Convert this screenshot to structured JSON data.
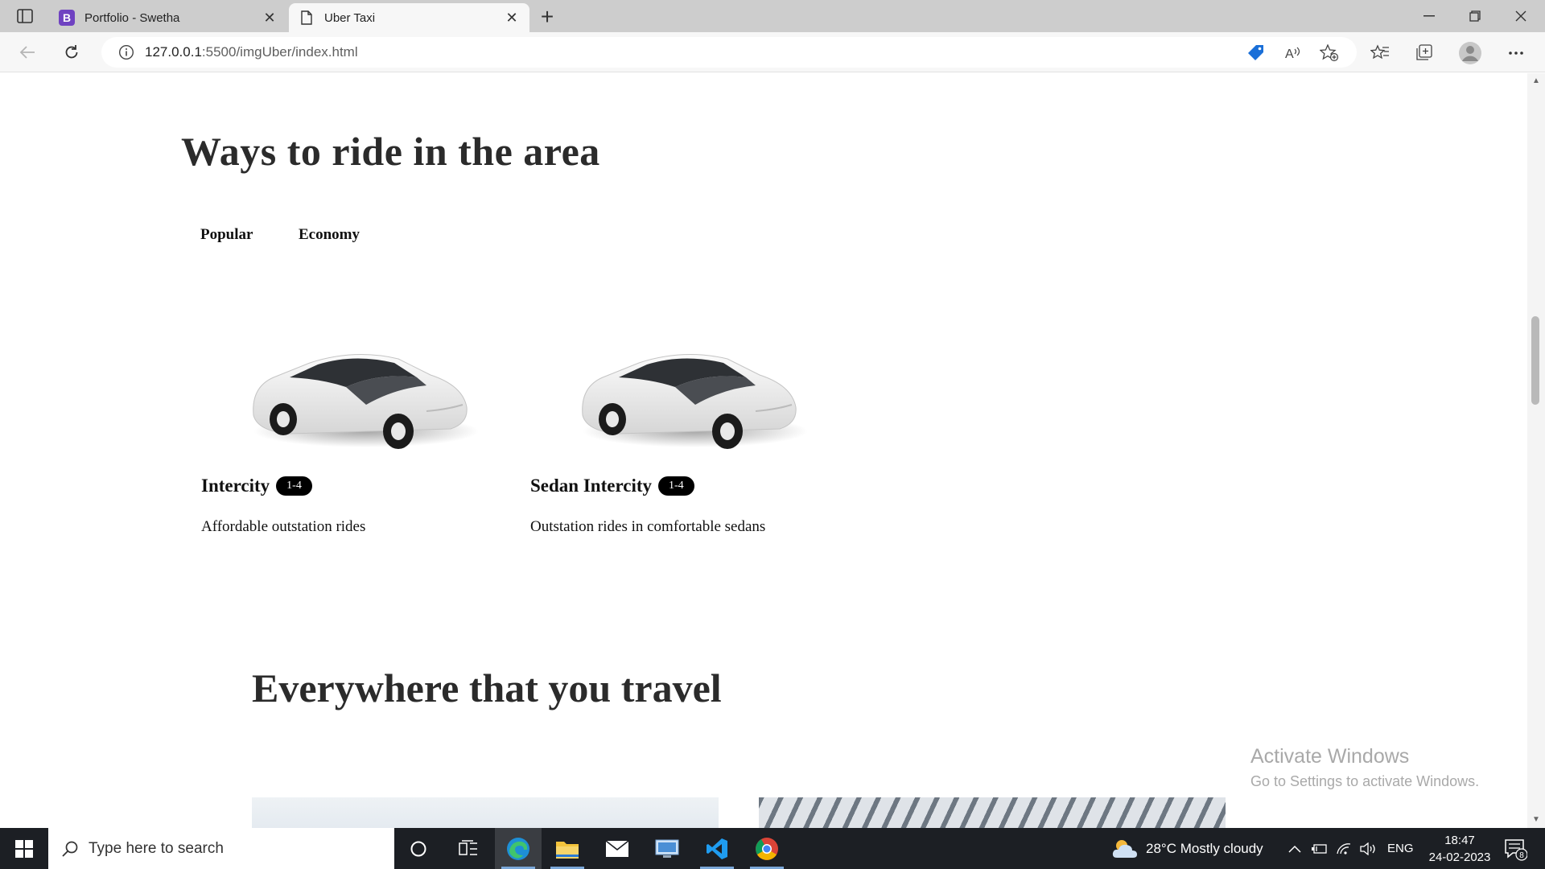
{
  "browser": {
    "tabs": [
      {
        "title": "Portfolio - Swetha",
        "favicon": "B"
      },
      {
        "title": "Uber Taxi"
      }
    ],
    "url_host": "127.0.0.1",
    "url_path": ":5500/imgUber/index.html"
  },
  "section_rides": {
    "heading": "Ways to ride in the area",
    "tabs": [
      "Popular",
      "Economy"
    ],
    "cards": [
      {
        "name": "Intercity",
        "badge": "1-4",
        "description": "Affordable outstation rides"
      },
      {
        "name": "Sedan Intercity",
        "badge": "1-4",
        "description": "Outstation rides in comfortable sedans"
      }
    ]
  },
  "section_travel": {
    "heading": "Everywhere that you travel"
  },
  "watermark": {
    "line1": "Activate Windows",
    "line2": "Go to Settings to activate Windows."
  },
  "taskbar": {
    "search_placeholder": "Type here to search",
    "weather": "28°C  Mostly cloudy",
    "language": "ENG",
    "time": "18:47",
    "date": "24-02-2023",
    "notification_count": "8"
  },
  "colors": {
    "accent_badge": "#000000",
    "taskbar": "#1c1f24",
    "tabbar": "#cdcdcd"
  }
}
